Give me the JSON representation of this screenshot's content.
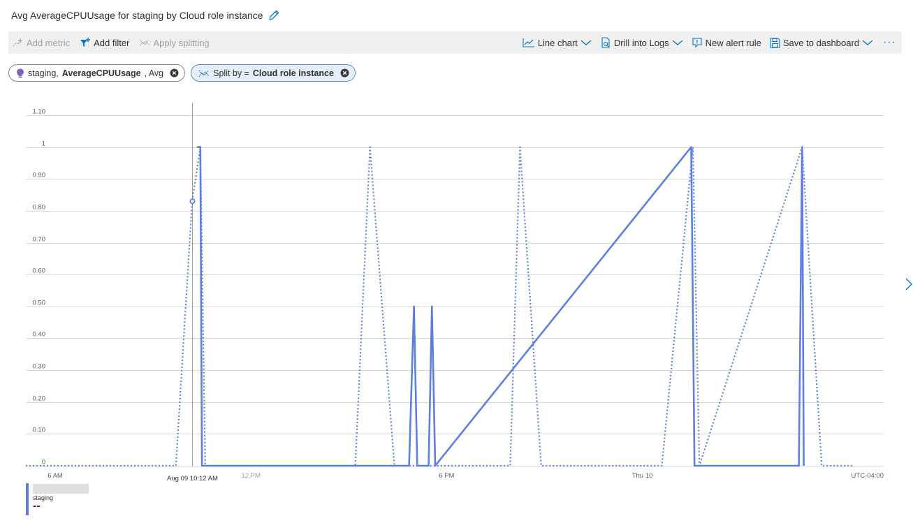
{
  "title": "Avg AverageCPUUsage for staging by Cloud role instance",
  "toolbar": {
    "add_metric": "Add metric",
    "add_filter": "Add filter",
    "apply_splitting": "Apply splitting",
    "line_chart": "Line chart",
    "drill_logs": "Drill into Logs",
    "new_alert": "New alert rule",
    "save_dashboard": "Save to dashboard",
    "more": "···"
  },
  "pills": {
    "metric": {
      "resource": "staging, ",
      "metric": "AverageCPUUsage",
      "agg": ", Avg"
    },
    "split": {
      "prefix": "Split by = ",
      "value": "Cloud role instance"
    }
  },
  "legend": {
    "name": "staging",
    "value": "--"
  },
  "colors": {
    "accent": "#0078d4",
    "series": "#5f7fe0",
    "grid": "#d8d8d8"
  },
  "chart_data": {
    "type": "line",
    "title": "",
    "xlabel": "",
    "ylabel": "",
    "ylim": [
      0,
      1.1
    ],
    "yticks": [
      "0",
      "0.10",
      "0.20",
      "0.30",
      "0.40",
      "0.50",
      "0.60",
      "0.70",
      "0.80",
      "0.90",
      "1",
      "1.10"
    ],
    "xticks": [
      "6 AM",
      "12 PM",
      "6 PM",
      "Thu 10",
      "UTC-04:00"
    ],
    "x_range_hours": [
      5.1,
      31.4
    ],
    "cursor": {
      "label": "Aug 09 10:12 AM",
      "hour": 10.2,
      "value": 0.83
    },
    "grid": true,
    "series": [
      {
        "name": "staging",
        "style": "dotted",
        "points": [
          [
            5.1,
            0
          ],
          [
            9.7,
            0
          ],
          [
            10.2,
            0.83
          ],
          [
            10.45,
            1
          ],
          [
            10.6,
            0
          ],
          [
            15.2,
            0
          ],
          [
            15.65,
            1
          ],
          [
            16.4,
            0
          ],
          [
            19.95,
            0
          ],
          [
            20.25,
            1
          ],
          [
            20.9,
            0
          ],
          [
            24.6,
            0
          ],
          [
            25.55,
            1
          ],
          [
            25.75,
            0
          ],
          [
            28.9,
            1
          ],
          [
            29.5,
            0
          ],
          [
            30.5,
            0
          ]
        ]
      },
      {
        "name": "staging",
        "style": "solid",
        "points": [
          [
            10.35,
            1
          ],
          [
            10.45,
            1
          ],
          [
            10.5,
            0
          ],
          [
            16.85,
            0
          ],
          [
            17.0,
            0.5
          ],
          [
            17.1,
            0
          ],
          [
            17.45,
            0
          ],
          [
            17.55,
            0.5
          ],
          [
            17.65,
            0
          ],
          [
            25.5,
            1
          ],
          [
            25.6,
            0
          ],
          [
            28.8,
            0
          ],
          [
            28.9,
            1
          ],
          [
            28.95,
            0
          ]
        ]
      }
    ]
  }
}
